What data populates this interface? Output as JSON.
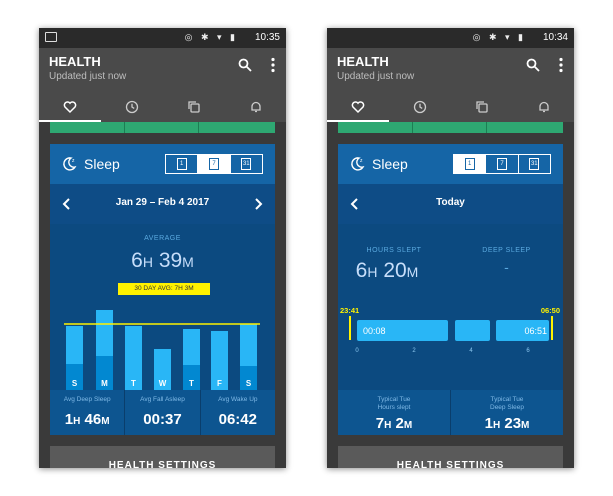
{
  "status_bar": {
    "left_time": "10:35",
    "right_time": "10:34",
    "icons": "◎ ✱ ▾ ▮"
  },
  "app": {
    "title": "HEALTH",
    "subtitle": "Updated just now"
  },
  "tabs": [
    "heart-icon",
    "clock-icon",
    "copy-icon",
    "bell-icon"
  ],
  "card": {
    "title": "Sleep",
    "segments": [
      "1",
      "7",
      "31"
    ]
  },
  "weekly": {
    "date_range": "Jan 29 – Feb 4 2017",
    "average_caption": "AVERAGE",
    "average_hours": "6",
    "average_minutes": "39",
    "avg_badge": "30 DAY AVG: 7H 3M",
    "days": [
      "S",
      "M",
      "T",
      "W",
      "T",
      "F",
      "S"
    ],
    "stats": [
      {
        "label": "Avg Deep Sleep",
        "value_num1": "1",
        "unit1": "H",
        "value_num2": "46",
        "unit2": "M"
      },
      {
        "label": "Avg Fall Asleep",
        "value": "00:37"
      },
      {
        "label": "Avg Wake Up",
        "value": "06:42"
      }
    ]
  },
  "daily": {
    "date_label": "Today",
    "hours_slept_caption": "HOURS SLEPT",
    "deep_sleep_caption": "DEEP SLEEP",
    "hours": "6",
    "minutes": "20",
    "deep_sleep_value": "-",
    "start_time": "23:41",
    "end_time": "06:50",
    "segment_start_label": "00:08",
    "segment_end_label": "06:51",
    "axis_ticks": [
      "0",
      "2",
      "4",
      "6"
    ],
    "stats": [
      {
        "label_line1": "Typical Tue",
        "label_line2": "Hours slept",
        "value_num1": "7",
        "unit1": "H",
        "value_num2": "2",
        "unit2": "M"
      },
      {
        "label_line1": "Typical Tue",
        "label_line2": "Deep Sleep",
        "value_num1": "1",
        "unit1": "H",
        "value_num2": "23",
        "unit2": "M"
      }
    ]
  },
  "settings_label": "HEALTH SETTINGS",
  "units": {
    "h": "H",
    "m": "M"
  },
  "colors": {
    "accent_yellow": "#fff200",
    "bar_light": "#29b6f6",
    "bar_dark": "#0288d1",
    "card_blue": "#1565a6",
    "green": "#2ea872"
  }
}
